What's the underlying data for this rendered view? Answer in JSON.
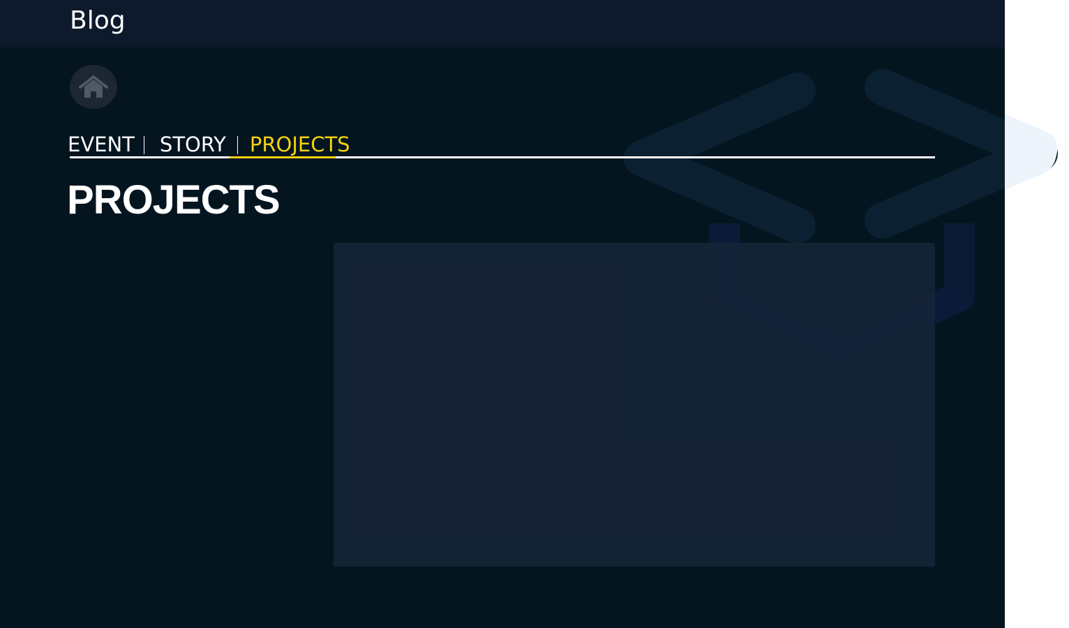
{
  "header": {
    "title": "Blog"
  },
  "home": {
    "icon": "home-icon"
  },
  "tabs": [
    {
      "label": "EVENT",
      "active": false
    },
    {
      "label": "STORY",
      "active": false
    },
    {
      "label": "PROJECTS",
      "active": true
    }
  ],
  "page": {
    "title": "PROJECTS"
  },
  "decoration": {
    "icon": "code-brackets-icon"
  },
  "colors": {
    "background": "#041520",
    "topbar": "#0c1a2b",
    "accent": "#f5d210",
    "panel": "#15243a"
  }
}
